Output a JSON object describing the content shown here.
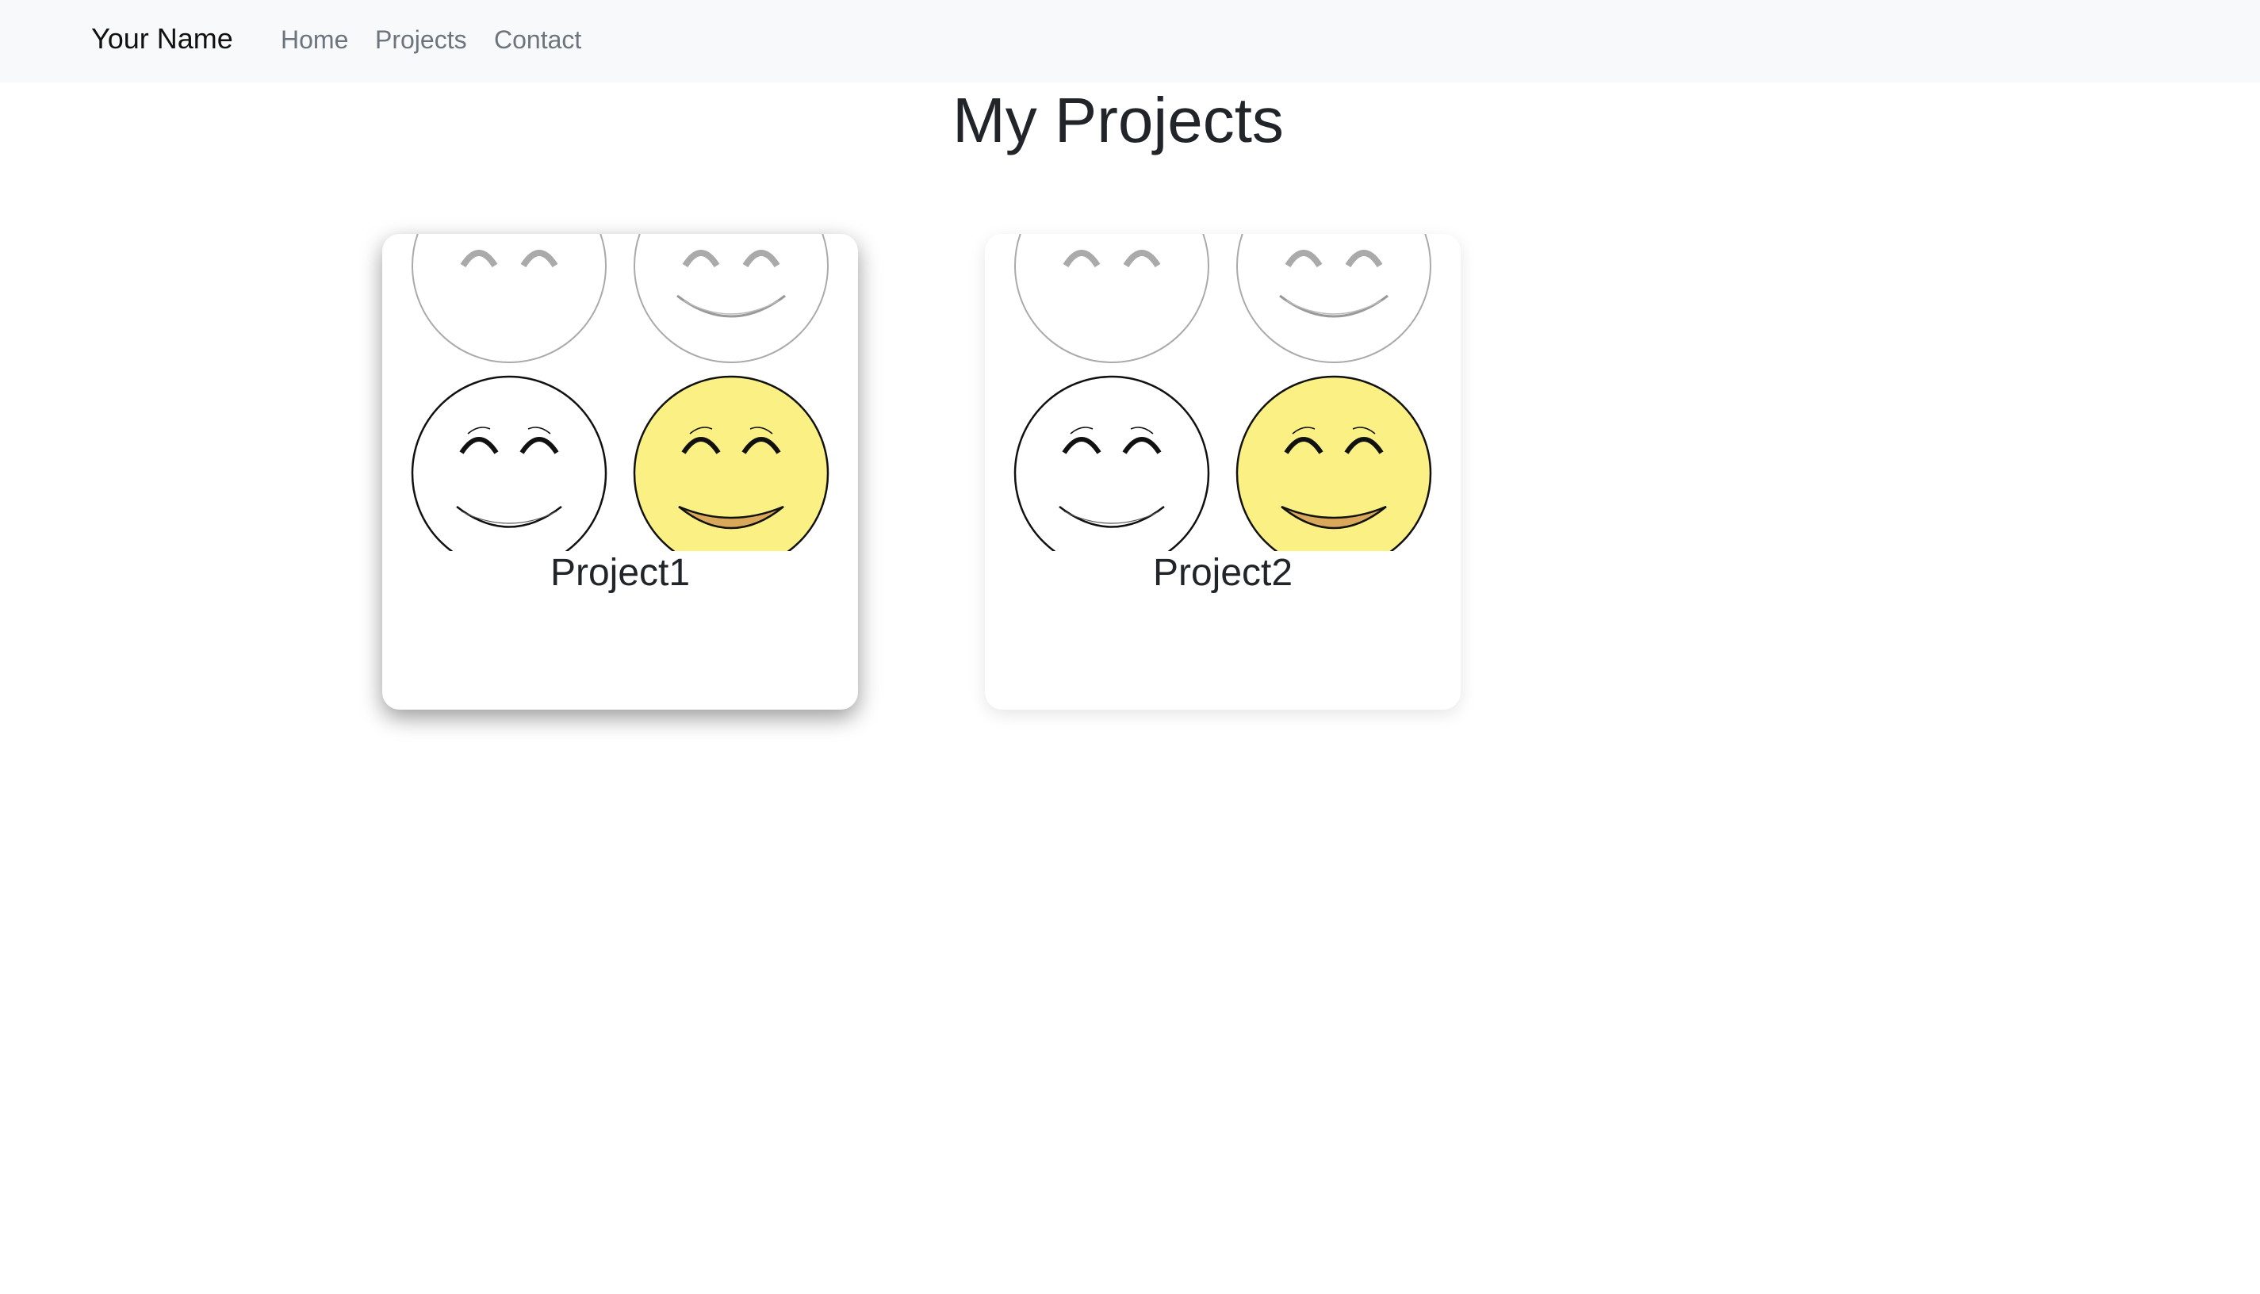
{
  "navbar": {
    "brand": "Your Name",
    "links": [
      {
        "label": "Home"
      },
      {
        "label": "Projects"
      },
      {
        "label": "Contact"
      }
    ],
    "background": "#f8f9fa"
  },
  "main": {
    "title": "My Projects",
    "projects": [
      {
        "title": "Project1",
        "image_icon": "smiley-faces-icon"
      },
      {
        "title": "Project2",
        "image_icon": "smiley-faces-icon"
      }
    ]
  },
  "colors": {
    "smiley_yellow": "#fbf084",
    "smile_fill": "#d9a85a",
    "text": "#212529",
    "nav_link": "#6c757d"
  }
}
